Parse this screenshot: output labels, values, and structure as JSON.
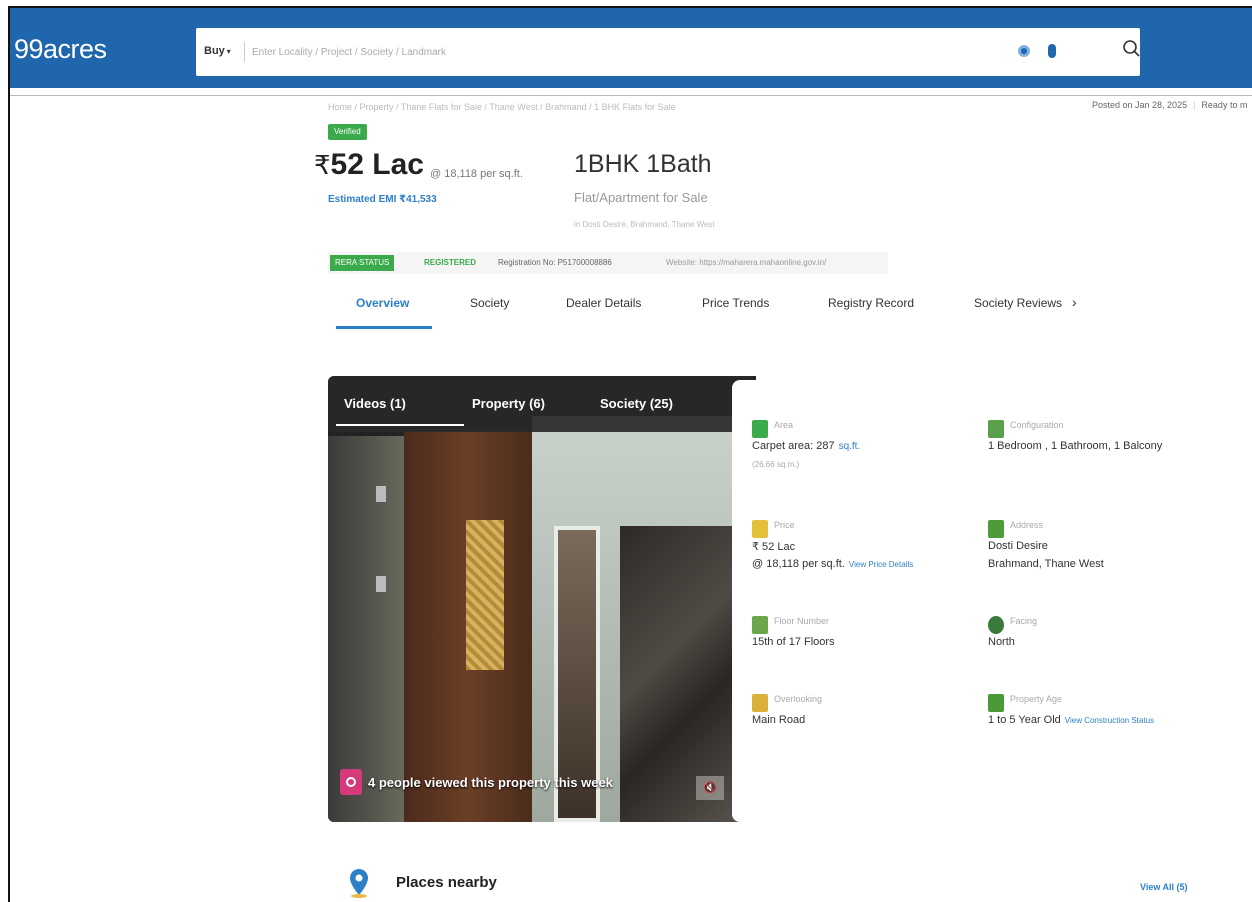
{
  "header": {
    "logo": "99acres",
    "search": {
      "buy_label": "Buy",
      "placeholder": "Enter Locality / Project / Society / Landmark"
    }
  },
  "breadcrumb": "Home / Property / Thane Flats for Sale / Thane West / Brahmand / 1 BHK Flats for Sale",
  "meta": {
    "posted": "Posted on Jan 28, 2025",
    "status": "Ready to m"
  },
  "listing": {
    "verified": "Verified",
    "price_symbol": "₹",
    "price": "52 Lac",
    "per_sqft": "@ 18,118 per sq.ft.",
    "emi": "Estimated EMI ₹41,533",
    "bhk": "1BHK 1Bath",
    "type": "Flat/Apartment for Sale",
    "location": "in Dosti Desire, Brahmand, Thane West"
  },
  "rera": {
    "status_label": "RERA STATUS",
    "registered": "REGISTERED",
    "registration_no": "Registration No: P51700008886",
    "website": "Website: https://maharera.mahaonline.gov.in/"
  },
  "tabs": [
    "Overview",
    "Society",
    "Dealer Details",
    "Price Trends",
    "Registry Record",
    "Society Reviews"
  ],
  "media": {
    "tabs": [
      "Videos (1)",
      "Property (6)",
      "Society (25)"
    ],
    "views": "4 people viewed this property this week"
  },
  "details": {
    "area": {
      "label": "Area",
      "value": "Carpet area: 287",
      "unit": "sq.ft.",
      "sub": "(26.66 sq.m.)"
    },
    "configuration": {
      "label": "Configuration",
      "value": "1 Bedroom , 1 Bathroom, 1 Balcony"
    },
    "price": {
      "label": "Price",
      "value": "₹ 52 Lac",
      "sub": "@ 18,118 per sq.ft.",
      "link": "View Price Details"
    },
    "address": {
      "label": "Address",
      "value": "Dosti Desire",
      "sub": "Brahmand, Thane West"
    },
    "floor": {
      "label": "Floor Number",
      "value": "15th of 17 Floors"
    },
    "facing": {
      "label": "Facing",
      "value": "North"
    },
    "overlooking": {
      "label": "Overlooking",
      "value": "Main Road"
    },
    "age": {
      "label": "Property Age",
      "value": "1 to 5 Year Old",
      "link": "View Construction Status"
    }
  },
  "places": {
    "title": "Places nearby",
    "view_all": "View All (5)"
  },
  "colors": {
    "brand": "#1f66ad",
    "accent": "#2d7fc7",
    "green": "#3aaa4a",
    "views_badge": "#d63a7a"
  }
}
